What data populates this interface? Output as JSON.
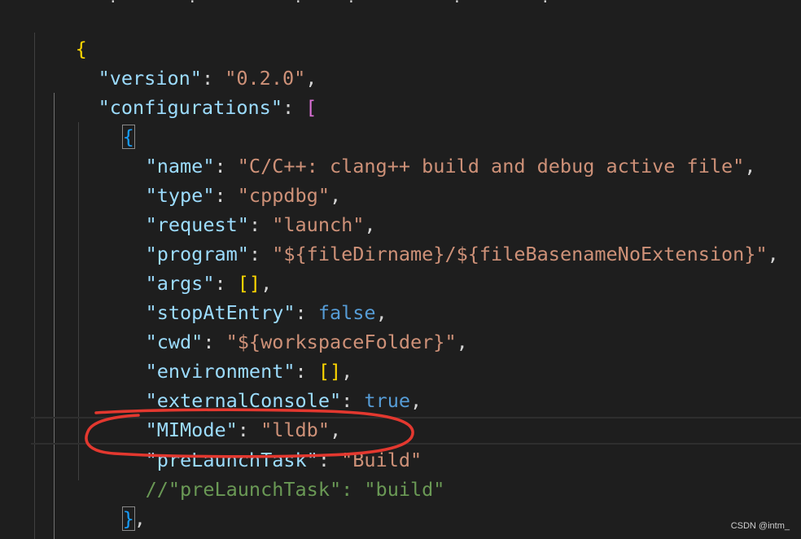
{
  "editor": {
    "top_fragment": "    .        .           .     .           .         .",
    "lines": {
      "l1": {
        "open": "{"
      },
      "l2": {
        "key": "\"version\"",
        "colon": ": ",
        "val": "\"0.2.0\"",
        "end": ","
      },
      "l3": {
        "key": "\"configurations\"",
        "colon": ": ",
        "open": "["
      },
      "l4": {
        "open": "{"
      },
      "l5": {
        "key": "\"name\"",
        "colon": ": ",
        "val": "\"C/C++: clang++ build and debug active file\"",
        "end": ","
      },
      "l6": {
        "key": "\"type\"",
        "colon": ": ",
        "val": "\"cppdbg\"",
        "end": ","
      },
      "l7": {
        "key": "\"request\"",
        "colon": ": ",
        "val": "\"launch\"",
        "end": ","
      },
      "l8": {
        "key": "\"program\"",
        "colon": ": ",
        "val": "\"${fileDirname}/${fileBasenameNoExtension}\"",
        "end": ","
      },
      "l9": {
        "key": "\"args\"",
        "colon": ": ",
        "val": "[]",
        "end": ","
      },
      "l10": {
        "key": "\"stopAtEntry\"",
        "colon": ": ",
        "val": "false",
        "end": ","
      },
      "l11": {
        "key": "\"cwd\"",
        "colon": ": ",
        "val": "\"${workspaceFolder}\"",
        "end": ","
      },
      "l12": {
        "key": "\"environment\"",
        "colon": ": ",
        "val": "[]",
        "end": ","
      },
      "l13": {
        "key": "\"externalConsole\"",
        "colon": ": ",
        "val": "true",
        "end": ","
      },
      "l14": {
        "key": "\"MIMode\"",
        "colon": ": ",
        "val": "\"lldb\"",
        "end": ","
      },
      "l15": {
        "key": "\"preLaunchTask\"",
        "colon": ": ",
        "val": "\"Build\""
      },
      "l16": {
        "comment": "//\"preLaunchTask\": \"build\""
      },
      "l17": {
        "close": "}",
        "end": ","
      }
    }
  },
  "annotation": {
    "color": "#e3382f",
    "shape": "hand-drawn ellipse around preLaunchTask line"
  },
  "theme": {
    "background": "#1e1e1e",
    "key_color": "#9cdcfe",
    "string_color": "#ce9178",
    "keyword_color": "#569cd6",
    "comment_color": "#6a9955",
    "bracket_gold": "#ffd700",
    "bracket_purple": "#da70d6",
    "bracket_blue": "#179fff"
  },
  "watermark": "CSDN @intm_"
}
